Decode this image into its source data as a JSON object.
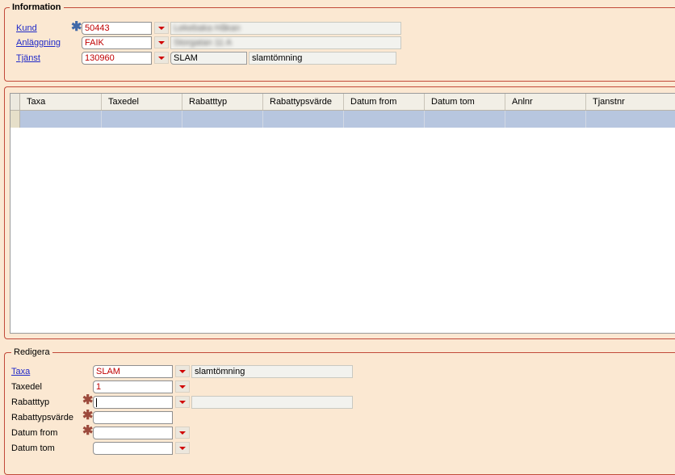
{
  "information": {
    "title": "Information",
    "kund": {
      "label": "Kund",
      "value": "50443",
      "name": "Lekebaka Håkan"
    },
    "anlaggning": {
      "label": "Anläggning",
      "value": "FAIK",
      "name": "Storgatan 11 A"
    },
    "tjanst": {
      "label": "Tjänst",
      "value": "130960",
      "code": "SLAM",
      "description": "slamtömning"
    }
  },
  "grid": {
    "columns": [
      "Taxa",
      "Taxedel",
      "Rabatttyp",
      "Rabattypsvärde",
      "Datum from",
      "Datum tom",
      "Anlnr",
      "Tjanstnr"
    ]
  },
  "redigera": {
    "title": "Redigera",
    "taxa": {
      "label": "Taxa",
      "value": "SLAM",
      "description": "slamtömning"
    },
    "taxedel": {
      "label": "Taxedel",
      "value": "1"
    },
    "rabatttyp": {
      "label": "Rabatttyp",
      "value": "",
      "description": ""
    },
    "rabattypsvarde": {
      "label": "Rabattypsvärde",
      "value": ""
    },
    "datum_from": {
      "label": "Datum from",
      "value": ""
    },
    "datum_tom": {
      "label": "Datum tom",
      "value": ""
    }
  },
  "colors": {
    "background": "#fbe8d2",
    "group_border": "#c24a3a",
    "link": "#1f29c9",
    "field_text": "#c00000",
    "selected_row": "#b7c6df"
  }
}
